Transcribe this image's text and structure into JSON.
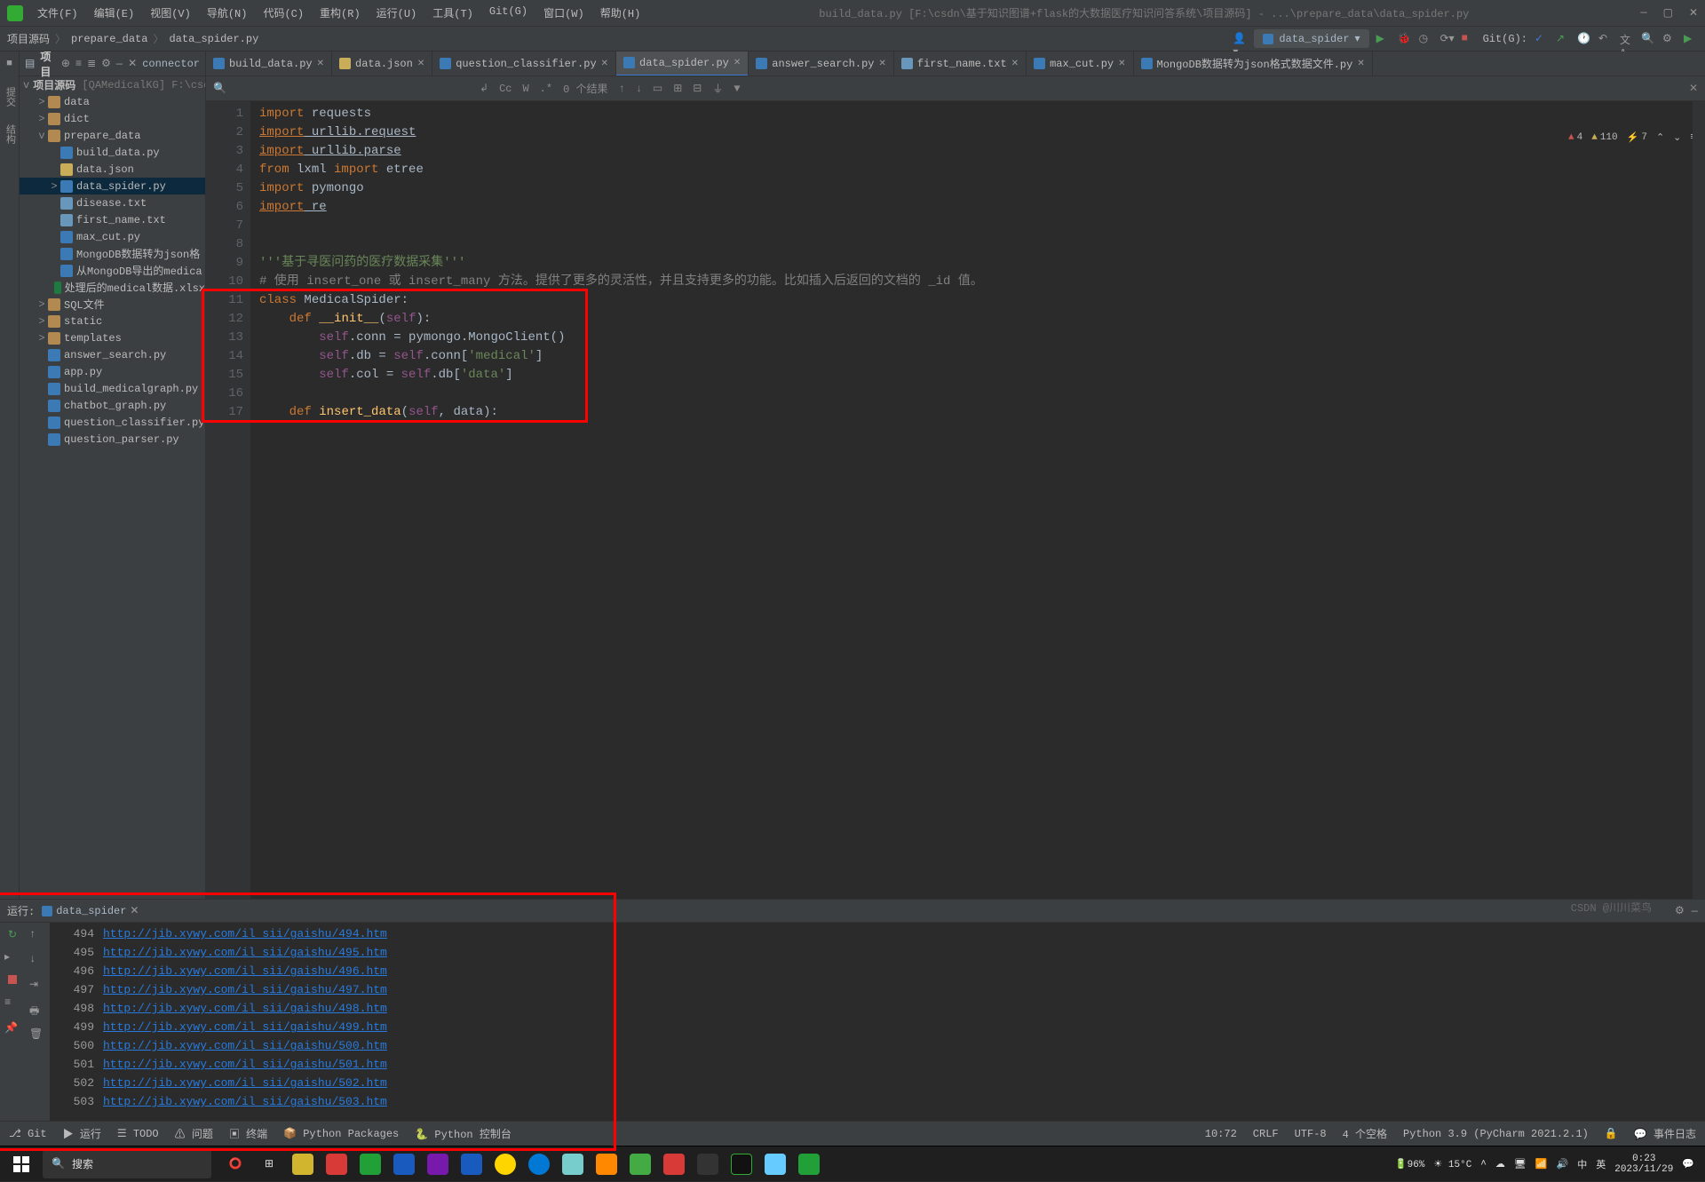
{
  "window": {
    "title": "build_data.py [F:\\csdn\\基于知识图谱+flask的大数据医疗知识问答系统\\项目源码] - ...\\prepare_data\\data_spider.py"
  },
  "menu": [
    "文件(F)",
    "编辑(E)",
    "视图(V)",
    "导航(N)",
    "代码(C)",
    "重构(R)",
    "运行(U)",
    "工具(T)",
    "Git(G)",
    "窗口(W)",
    "帮助(H)"
  ],
  "breadcrumb": [
    "项目源码",
    "prepare_data",
    "data_spider.py"
  ],
  "runconfig": "data_spider",
  "gitlabel": "Git(G):",
  "project": {
    "title": "项目",
    "root": {
      "name": "项目源码",
      "qual": "[QAMedicalKG]",
      "path": "F:\\csd"
    },
    "items": [
      {
        "indent": 1,
        "arrow": ">",
        "icon": "fold",
        "label": "data"
      },
      {
        "indent": 1,
        "arrow": ">",
        "icon": "fold",
        "label": "dict"
      },
      {
        "indent": 1,
        "arrow": "v",
        "icon": "fold",
        "label": "prepare_data"
      },
      {
        "indent": 2,
        "arrow": "",
        "icon": "py",
        "label": "build_data.py"
      },
      {
        "indent": 2,
        "arrow": "",
        "icon": "json",
        "label": "data.json"
      },
      {
        "indent": 2,
        "arrow": ">",
        "icon": "py",
        "label": "data_spider.py",
        "sel": true
      },
      {
        "indent": 2,
        "arrow": "",
        "icon": "txt",
        "label": "disease.txt"
      },
      {
        "indent": 2,
        "arrow": "",
        "icon": "txt",
        "label": "first_name.txt"
      },
      {
        "indent": 2,
        "arrow": "",
        "icon": "py",
        "label": "max_cut.py"
      },
      {
        "indent": 2,
        "arrow": "",
        "icon": "py",
        "label": "MongoDB数据转为json格"
      },
      {
        "indent": 2,
        "arrow": "",
        "icon": "py",
        "label": "从MongoDB导出的medica"
      },
      {
        "indent": 2,
        "arrow": "",
        "icon": "xls",
        "label": "处理后的medical数据.xlsx"
      },
      {
        "indent": 1,
        "arrow": ">",
        "icon": "fold",
        "label": "SQL文件"
      },
      {
        "indent": 1,
        "arrow": ">",
        "icon": "fold",
        "label": "static"
      },
      {
        "indent": 1,
        "arrow": ">",
        "icon": "fold",
        "label": "templates"
      },
      {
        "indent": 1,
        "arrow": "",
        "icon": "py",
        "label": "answer_search.py"
      },
      {
        "indent": 1,
        "arrow": "",
        "icon": "py",
        "label": "app.py"
      },
      {
        "indent": 1,
        "arrow": "",
        "icon": "py",
        "label": "build_medicalgraph.py"
      },
      {
        "indent": 1,
        "arrow": "",
        "icon": "py",
        "label": "chatbot_graph.py"
      },
      {
        "indent": 1,
        "arrow": "",
        "icon": "py",
        "label": "question_classifier.py"
      },
      {
        "indent": 1,
        "arrow": "",
        "icon": "py",
        "label": "question_parser.py"
      }
    ]
  },
  "tabs": [
    {
      "icon": "py",
      "label": "build_data.py"
    },
    {
      "icon": "json",
      "label": "data.json"
    },
    {
      "icon": "py",
      "label": "question_classifier.py"
    },
    {
      "icon": "py",
      "label": "data_spider.py",
      "active": true
    },
    {
      "icon": "py",
      "label": "answer_search.py"
    },
    {
      "icon": "txt",
      "label": "first_name.txt"
    },
    {
      "icon": "py",
      "label": "max_cut.py"
    },
    {
      "icon": "py",
      "label": "MongoDB数据转为json格式数据文件.py"
    }
  ],
  "findbar": {
    "results": "0 个结果"
  },
  "inspections": {
    "err": "4",
    "warn": "110",
    "weak": "7"
  },
  "code": {
    "lines": [
      1,
      2,
      3,
      4,
      5,
      6,
      7,
      8,
      9,
      10,
      11,
      12,
      13,
      14,
      15,
      16,
      17
    ],
    "content": [
      "<span class='kw'>import</span> requests",
      "<span class='kw und'>import</span><span class='und'> urllib.request</span>",
      "<span class='kw und'>import</span><span class='und'> urllib.parse</span>",
      "<span class='kw'>from</span> lxml <span class='kw'>import</span> etree",
      "<span class='kw'>import</span> pymongo",
      "<span class='kw und'>import</span><span class='und'> re</span>",
      "",
      "",
      "<span class='str'>'''基于寻医问药的医疗数据采集'''</span>",
      "<span class='com'># 使用 insert_one 或 insert_many 方法。提供了更多的灵活性，并且支持更多的功能。比如插入后返回的文档的 _id 值。</span>",
      "<span class='kw'>class</span> <span class='cls'>MedicalSpider</span>:",
      "    <span class='kw'>def</span> <span class='fn'>__init__</span>(<span class='self'>self</span>):",
      "        <span class='self'>self</span>.conn = pymongo.MongoClient()",
      "        <span class='self'>self</span>.db = <span class='self'>self</span>.conn[<span class='str'>'medical'</span>]",
      "        <span class='self'>self</span>.col = <span class='self'>self</span>.db[<span class='str'>'data'</span>]",
      "",
      "    <span class='kw'>def</span> <span class='fn'>insert_data</span>(<span class='self'>self</span>, data):"
    ]
  },
  "run": {
    "label": "运行:",
    "tab": "data_spider",
    "output": [
      {
        "n": "494",
        "u": "http://jib.xywy.com/il_sii/gaishu/494.htm"
      },
      {
        "n": "495",
        "u": "http://jib.xywy.com/il_sii/gaishu/495.htm"
      },
      {
        "n": "496",
        "u": "http://jib.xywy.com/il_sii/gaishu/496.htm"
      },
      {
        "n": "497",
        "u": "http://jib.xywy.com/il_sii/gaishu/497.htm"
      },
      {
        "n": "498",
        "u": "http://jib.xywy.com/il_sii/gaishu/498.htm"
      },
      {
        "n": "499",
        "u": "http://jib.xywy.com/il_sii/gaishu/499.htm"
      },
      {
        "n": "500",
        "u": "http://jib.xywy.com/il_sii/gaishu/500.htm"
      },
      {
        "n": "501",
        "u": "http://jib.xywy.com/il_sii/gaishu/501.htm"
      },
      {
        "n": "502",
        "u": "http://jib.xywy.com/il_sii/gaishu/502.htm"
      },
      {
        "n": "503",
        "u": "http://jib.xywy.com/il_sii/gaishu/503.htm"
      }
    ]
  },
  "bottombar": {
    "items": [
      "Git",
      "运行",
      "TODO",
      "问题",
      "终端",
      "Python Packages",
      "Python 控制台"
    ],
    "events": "事件日志"
  },
  "statusbar": {
    "pos": "10:72",
    "eol": "CRLF",
    "enc": "UTF-8",
    "indent": "4 个空格",
    "py": "Python 3.9 (PyCharm 2021.2.1)"
  },
  "taskbar": {
    "search": "搜索",
    "battery": "96%",
    "temp": "15°C",
    "time": "0:23",
    "date": "2023/11/29",
    "watermark": "CSDN @川川菜鸟"
  }
}
